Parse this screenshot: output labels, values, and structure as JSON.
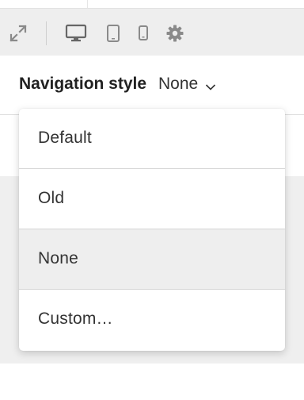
{
  "toolbar": {
    "icons": [
      "expand-icon",
      "desktop-icon",
      "tablet-icon",
      "mobile-icon",
      "gear-icon"
    ]
  },
  "navigation": {
    "label": "Navigation style",
    "value": "None"
  },
  "menu": {
    "items": [
      {
        "label": "Default"
      },
      {
        "label": "Old"
      },
      {
        "label": "None",
        "selected": true
      },
      {
        "label": "Custom…"
      }
    ]
  },
  "colors": {
    "toolbar_bg": "#eeeeee",
    "selected_bg": "#eeeeee",
    "icon": "#7a7a7a"
  }
}
